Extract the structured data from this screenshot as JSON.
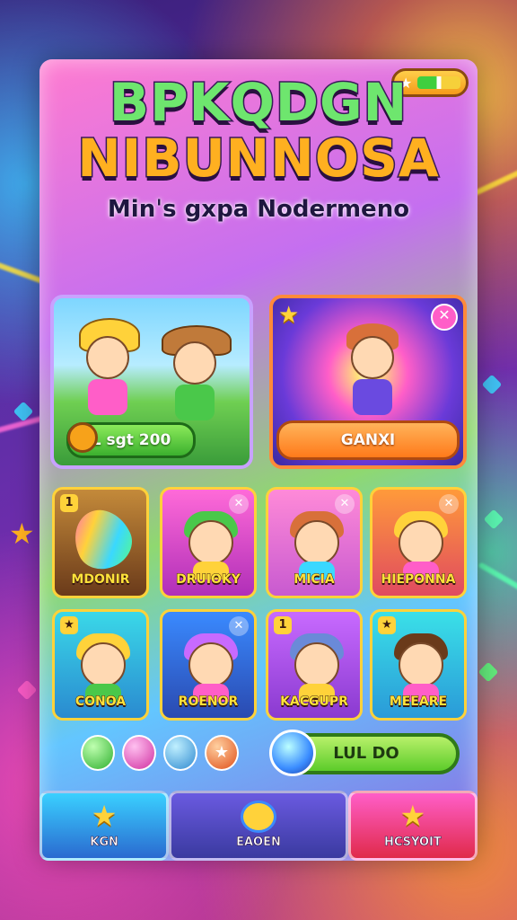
{
  "header": {
    "title_line1": "BPKQDGN",
    "title_line2": "NIBUNNOSA",
    "subtitle": "Minˈs gxpa Nodermeno"
  },
  "featured": [
    {
      "label": "L sgt 200",
      "icon": "coin-icon"
    },
    {
      "label": "GANⅪ",
      "icon": "close-icon"
    }
  ],
  "tiles": [
    {
      "label": "MDONIR",
      "badge": "1",
      "colors": [
        "#c48a3a",
        "#6a3a1a"
      ]
    },
    {
      "label": "DRUIOKY",
      "badge": "",
      "colors": [
        "#ff6ad8",
        "#b02fb8"
      ]
    },
    {
      "label": "MICIA",
      "badge": "",
      "colors": [
        "#ff8ad8",
        "#c85ad0"
      ]
    },
    {
      "label": "HIEPONNA",
      "badge": "",
      "colors": [
        "#ff9a3a",
        "#e04a60"
      ]
    },
    {
      "label": "CONOA",
      "badge": "",
      "colors": [
        "#3ad8e8",
        "#2a8ad0"
      ]
    },
    {
      "label": "ROENOR",
      "badge": "",
      "colors": [
        "#3a8aff",
        "#2a4ab0"
      ]
    },
    {
      "label": "KACGUPR",
      "badge": "1",
      "colors": [
        "#c86aff",
        "#8a3ad0"
      ]
    },
    {
      "label": "MEEARE",
      "badge": "",
      "colors": [
        "#3ae0e8",
        "#2a9ad8"
      ]
    }
  ],
  "actions": {
    "play_label": "LUL DO"
  },
  "nav": [
    {
      "label": "KGN",
      "icon": "star-icon"
    },
    {
      "label": "EAOEN",
      "icon": "inbox-icon"
    },
    {
      "label": "HCSYOIT",
      "icon": "star-icon"
    }
  ],
  "colors": {
    "accent_green": "#5ccc2a",
    "accent_orange": "#ff7a1a",
    "accent_yellow": "#ffd23a"
  }
}
